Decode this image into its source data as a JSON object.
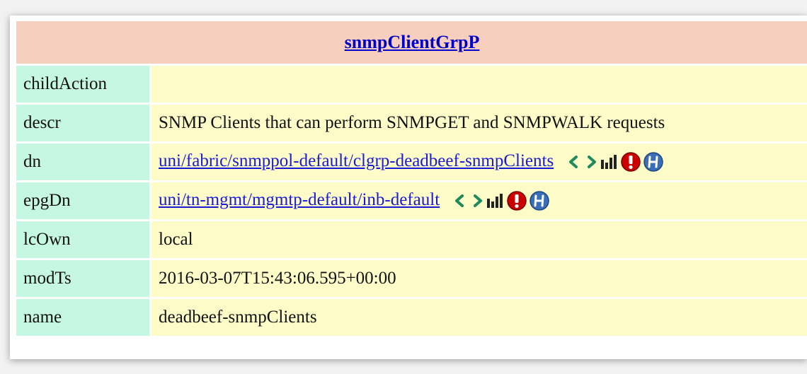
{
  "title": "snmpClientGrpP",
  "rows": [
    {
      "key": "childAction",
      "value": ""
    },
    {
      "key": "descr",
      "value": "SNMP Clients that can perform SNMPGET and SNMPWALK requests"
    },
    {
      "key": "dn",
      "value": "uni/fabric/snmppol-default/clgrp-deadbeef-snmpClients",
      "link": true
    },
    {
      "key": "epgDn",
      "value": "uni/tn-mgmt/mgmtp-default/inb-default",
      "link": true
    },
    {
      "key": "lcOwn",
      "value": "local"
    },
    {
      "key": "modTs",
      "value": "2016-03-07T15:43:06.595+00:00"
    },
    {
      "key": "name",
      "value": "deadbeef-snmpClients"
    }
  ],
  "icons": [
    "chevron-left-icon",
    "chevron-right-icon",
    "stats-bars-icon",
    "fault-alert-icon",
    "history-icon"
  ],
  "colors": {
    "title_bg": "#f7cfbf",
    "key_bg": "#c6f7e2",
    "value_bg": "#fdfcc9",
    "link": "#1a1ad6",
    "chevron": "#1f8a5a",
    "fault": "#cc0000",
    "history": "#3a6fb8"
  }
}
